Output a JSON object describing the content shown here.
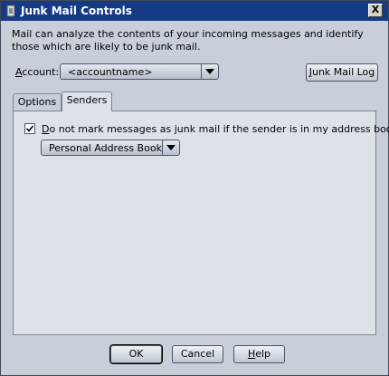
{
  "window": {
    "title": "Junk Mail Controls",
    "close_glyph": "X"
  },
  "description": "Mail can analyze the contents of your incoming messages and identify those which are likely to be junk mail.",
  "account": {
    "label_first": "A",
    "label_rest": "ccount:",
    "value": "<accountname>"
  },
  "junk_mail_log": {
    "label_first": "J",
    "label_rest": "unk Mail Log"
  },
  "tabs": [
    {
      "label": "Options"
    },
    {
      "label": "Senders"
    }
  ],
  "senders": {
    "checkbox_checked": true,
    "checkbox_label_first": "D",
    "checkbox_label_rest": "o not mark messages as junk mail if the sender is in my address book:",
    "address_book": "Personal Address Book"
  },
  "buttons": {
    "ok": "OK",
    "cancel": "Cancel",
    "help_first": "H",
    "help_rest": "elp"
  }
}
